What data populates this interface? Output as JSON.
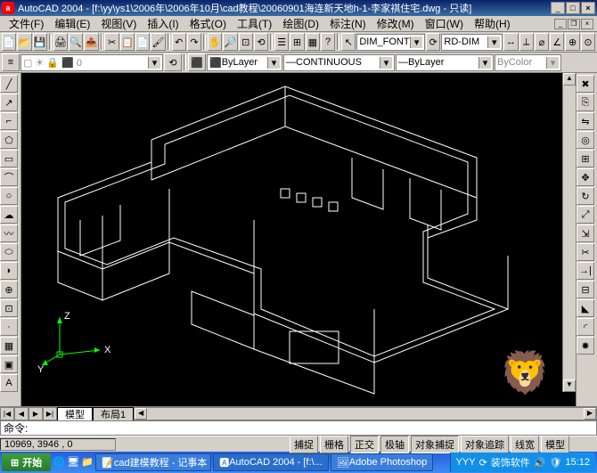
{
  "title": "AutoCAD 2004 - [f:\\yy\\ys1\\2006年\\2006年10月\\cad教程\\20060901海连新天地h-1-李家祺住宅.dwg - 只读]",
  "app_icon_label": "a",
  "menu": {
    "items": [
      "文件(F)",
      "编辑(E)",
      "视图(V)",
      "插入(I)",
      "格式(O)",
      "工具(T)",
      "绘图(D)",
      "标注(N)",
      "修改(M)",
      "窗口(W)",
      "帮助(H)"
    ]
  },
  "row1_dd1": "DIM_FONT",
  "row1_dd2": "RD-DIM",
  "layer": {
    "dd": "ByLayer",
    "linetype": "CONTINUOUS",
    "lineweight": "ByLayer",
    "bycolor": "ByColor"
  },
  "tabs": {
    "nav": [
      "|◀",
      "◀",
      "▶",
      "▶|"
    ],
    "model": "模型",
    "layout1": "布局1"
  },
  "cmd": {
    "label": "命令:"
  },
  "status": {
    "coords": "10969, 3946 , 0",
    "buttons": [
      "捕捉",
      "栅格",
      "正交",
      "极轴",
      "对象捕捉",
      "对象追踪",
      "线宽",
      "模型"
    ]
  },
  "taskbar": {
    "start": "开始",
    "tasks": [
      "cad建模教程 - 记事本",
      "AutoCAD 2004 - [f:\\...",
      "Adobe Photoshop"
    ],
    "tray_text": "YYY",
    "tray_text2": "装饰软件",
    "clock": "15:12"
  },
  "ucs": {
    "x": "X",
    "y": "Y",
    "z": "Z"
  },
  "colors": {
    "canvas": "#000000",
    "wire": "#ffffff",
    "ucs": "#00ff00"
  }
}
